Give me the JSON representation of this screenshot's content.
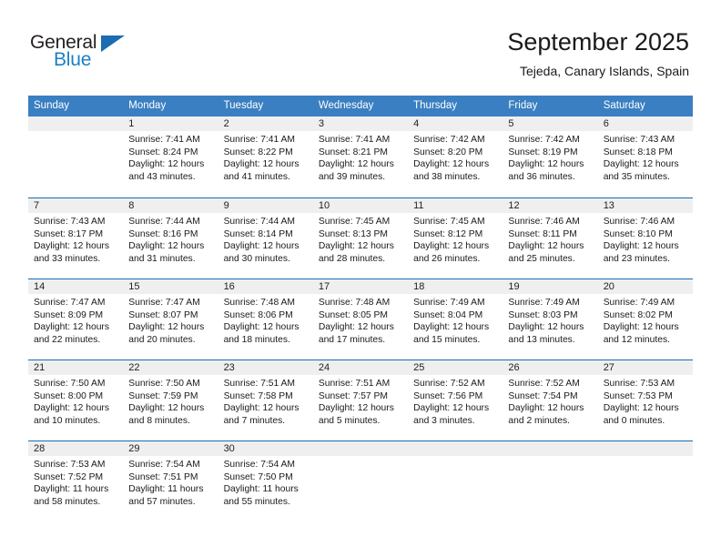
{
  "brand": {
    "name_part1": "General",
    "name_part2": "Blue",
    "triangle_icon": "triangle-icon",
    "colors": {
      "dark": "#231f20",
      "blue": "#1b7fc4",
      "triangle": "#1b6cb0"
    }
  },
  "header": {
    "title": "September 2025",
    "subtitle": "Tejeda, Canary Islands, Spain"
  },
  "theme": {
    "header_blue": "#3a7fc1",
    "row_divider_blue": "#1b6cb0",
    "day_band_gray": "#efefef"
  },
  "calendar": {
    "weekdays": [
      "Sunday",
      "Monday",
      "Tuesday",
      "Wednesday",
      "Thursday",
      "Friday",
      "Saturday"
    ],
    "weeks": [
      [
        {
          "day": "",
          "empty": true
        },
        {
          "day": "1",
          "sunrise": "Sunrise: 7:41 AM",
          "sunset": "Sunset: 8:24 PM",
          "daylight_line1": "Daylight: 12 hours",
          "daylight_line2": "and 43 minutes."
        },
        {
          "day": "2",
          "sunrise": "Sunrise: 7:41 AM",
          "sunset": "Sunset: 8:22 PM",
          "daylight_line1": "Daylight: 12 hours",
          "daylight_line2": "and 41 minutes."
        },
        {
          "day": "3",
          "sunrise": "Sunrise: 7:41 AM",
          "sunset": "Sunset: 8:21 PM",
          "daylight_line1": "Daylight: 12 hours",
          "daylight_line2": "and 39 minutes."
        },
        {
          "day": "4",
          "sunrise": "Sunrise: 7:42 AM",
          "sunset": "Sunset: 8:20 PM",
          "daylight_line1": "Daylight: 12 hours",
          "daylight_line2": "and 38 minutes."
        },
        {
          "day": "5",
          "sunrise": "Sunrise: 7:42 AM",
          "sunset": "Sunset: 8:19 PM",
          "daylight_line1": "Daylight: 12 hours",
          "daylight_line2": "and 36 minutes."
        },
        {
          "day": "6",
          "sunrise": "Sunrise: 7:43 AM",
          "sunset": "Sunset: 8:18 PM",
          "daylight_line1": "Daylight: 12 hours",
          "daylight_line2": "and 35 minutes."
        }
      ],
      [
        {
          "day": "7",
          "sunrise": "Sunrise: 7:43 AM",
          "sunset": "Sunset: 8:17 PM",
          "daylight_line1": "Daylight: 12 hours",
          "daylight_line2": "and 33 minutes."
        },
        {
          "day": "8",
          "sunrise": "Sunrise: 7:44 AM",
          "sunset": "Sunset: 8:16 PM",
          "daylight_line1": "Daylight: 12 hours",
          "daylight_line2": "and 31 minutes."
        },
        {
          "day": "9",
          "sunrise": "Sunrise: 7:44 AM",
          "sunset": "Sunset: 8:14 PM",
          "daylight_line1": "Daylight: 12 hours",
          "daylight_line2": "and 30 minutes."
        },
        {
          "day": "10",
          "sunrise": "Sunrise: 7:45 AM",
          "sunset": "Sunset: 8:13 PM",
          "daylight_line1": "Daylight: 12 hours",
          "daylight_line2": "and 28 minutes."
        },
        {
          "day": "11",
          "sunrise": "Sunrise: 7:45 AM",
          "sunset": "Sunset: 8:12 PM",
          "daylight_line1": "Daylight: 12 hours",
          "daylight_line2": "and 26 minutes."
        },
        {
          "day": "12",
          "sunrise": "Sunrise: 7:46 AM",
          "sunset": "Sunset: 8:11 PM",
          "daylight_line1": "Daylight: 12 hours",
          "daylight_line2": "and 25 minutes."
        },
        {
          "day": "13",
          "sunrise": "Sunrise: 7:46 AM",
          "sunset": "Sunset: 8:10 PM",
          "daylight_line1": "Daylight: 12 hours",
          "daylight_line2": "and 23 minutes."
        }
      ],
      [
        {
          "day": "14",
          "sunrise": "Sunrise: 7:47 AM",
          "sunset": "Sunset: 8:09 PM",
          "daylight_line1": "Daylight: 12 hours",
          "daylight_line2": "and 22 minutes."
        },
        {
          "day": "15",
          "sunrise": "Sunrise: 7:47 AM",
          "sunset": "Sunset: 8:07 PM",
          "daylight_line1": "Daylight: 12 hours",
          "daylight_line2": "and 20 minutes."
        },
        {
          "day": "16",
          "sunrise": "Sunrise: 7:48 AM",
          "sunset": "Sunset: 8:06 PM",
          "daylight_line1": "Daylight: 12 hours",
          "daylight_line2": "and 18 minutes."
        },
        {
          "day": "17",
          "sunrise": "Sunrise: 7:48 AM",
          "sunset": "Sunset: 8:05 PM",
          "daylight_line1": "Daylight: 12 hours",
          "daylight_line2": "and 17 minutes."
        },
        {
          "day": "18",
          "sunrise": "Sunrise: 7:49 AM",
          "sunset": "Sunset: 8:04 PM",
          "daylight_line1": "Daylight: 12 hours",
          "daylight_line2": "and 15 minutes."
        },
        {
          "day": "19",
          "sunrise": "Sunrise: 7:49 AM",
          "sunset": "Sunset: 8:03 PM",
          "daylight_line1": "Daylight: 12 hours",
          "daylight_line2": "and 13 minutes."
        },
        {
          "day": "20",
          "sunrise": "Sunrise: 7:49 AM",
          "sunset": "Sunset: 8:02 PM",
          "daylight_line1": "Daylight: 12 hours",
          "daylight_line2": "and 12 minutes."
        }
      ],
      [
        {
          "day": "21",
          "sunrise": "Sunrise: 7:50 AM",
          "sunset": "Sunset: 8:00 PM",
          "daylight_line1": "Daylight: 12 hours",
          "daylight_line2": "and 10 minutes."
        },
        {
          "day": "22",
          "sunrise": "Sunrise: 7:50 AM",
          "sunset": "Sunset: 7:59 PM",
          "daylight_line1": "Daylight: 12 hours",
          "daylight_line2": "and 8 minutes."
        },
        {
          "day": "23",
          "sunrise": "Sunrise: 7:51 AM",
          "sunset": "Sunset: 7:58 PM",
          "daylight_line1": "Daylight: 12 hours",
          "daylight_line2": "and 7 minutes."
        },
        {
          "day": "24",
          "sunrise": "Sunrise: 7:51 AM",
          "sunset": "Sunset: 7:57 PM",
          "daylight_line1": "Daylight: 12 hours",
          "daylight_line2": "and 5 minutes."
        },
        {
          "day": "25",
          "sunrise": "Sunrise: 7:52 AM",
          "sunset": "Sunset: 7:56 PM",
          "daylight_line1": "Daylight: 12 hours",
          "daylight_line2": "and 3 minutes."
        },
        {
          "day": "26",
          "sunrise": "Sunrise: 7:52 AM",
          "sunset": "Sunset: 7:54 PM",
          "daylight_line1": "Daylight: 12 hours",
          "daylight_line2": "and 2 minutes."
        },
        {
          "day": "27",
          "sunrise": "Sunrise: 7:53 AM",
          "sunset": "Sunset: 7:53 PM",
          "daylight_line1": "Daylight: 12 hours",
          "daylight_line2": "and 0 minutes."
        }
      ],
      [
        {
          "day": "28",
          "sunrise": "Sunrise: 7:53 AM",
          "sunset": "Sunset: 7:52 PM",
          "daylight_line1": "Daylight: 11 hours",
          "daylight_line2": "and 58 minutes."
        },
        {
          "day": "29",
          "sunrise": "Sunrise: 7:54 AM",
          "sunset": "Sunset: 7:51 PM",
          "daylight_line1": "Daylight: 11 hours",
          "daylight_line2": "and 57 minutes."
        },
        {
          "day": "30",
          "sunrise": "Sunrise: 7:54 AM",
          "sunset": "Sunset: 7:50 PM",
          "daylight_line1": "Daylight: 11 hours",
          "daylight_line2": "and 55 minutes."
        },
        {
          "day": "",
          "empty": true
        },
        {
          "day": "",
          "empty": true
        },
        {
          "day": "",
          "empty": true
        },
        {
          "day": "",
          "empty": true
        }
      ]
    ]
  }
}
